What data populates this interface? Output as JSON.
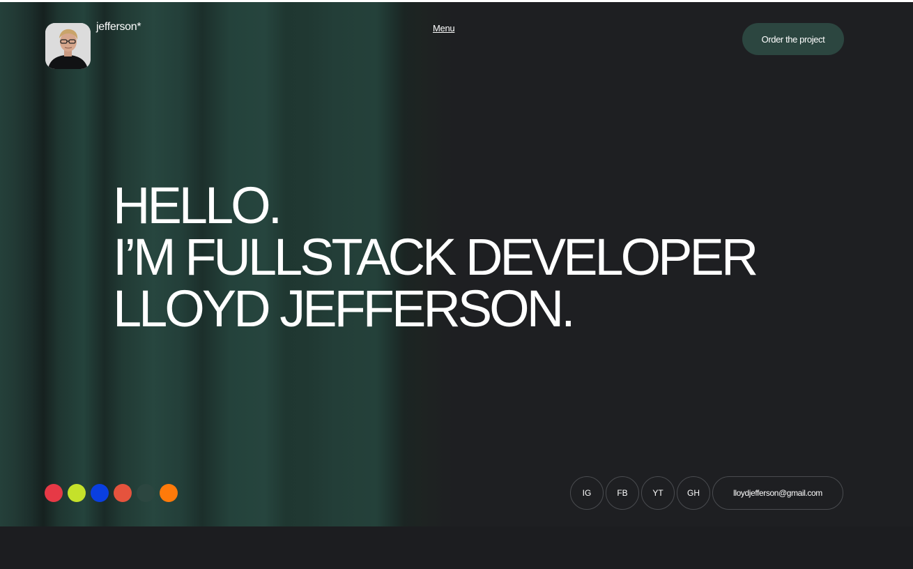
{
  "header": {
    "brand": "jefferson*",
    "menu_label": "Menu",
    "order_button_label": "Order the project"
  },
  "hero": {
    "lines": [
      "HELLO.",
      "I’M FULLSTACK DEVELOPER",
      "LLOYD JEFFERSON."
    ]
  },
  "swatches": [
    {
      "name": "red",
      "color": "#e63946"
    },
    {
      "name": "lime",
      "color": "#c5e12a"
    },
    {
      "name": "blue",
      "color": "#0a3fe0"
    },
    {
      "name": "coral",
      "color": "#e5533d"
    },
    {
      "name": "dark-green",
      "color": "#2c4640"
    },
    {
      "name": "orange",
      "color": "#ff7a0a"
    }
  ],
  "socials": [
    "IG",
    "FB",
    "YT",
    "GH"
  ],
  "contact": {
    "email": "lloydjefferson@gmail.com"
  },
  "colors": {
    "background": "#1e1f22",
    "accent": "#2c4640",
    "text": "#ffffff"
  }
}
